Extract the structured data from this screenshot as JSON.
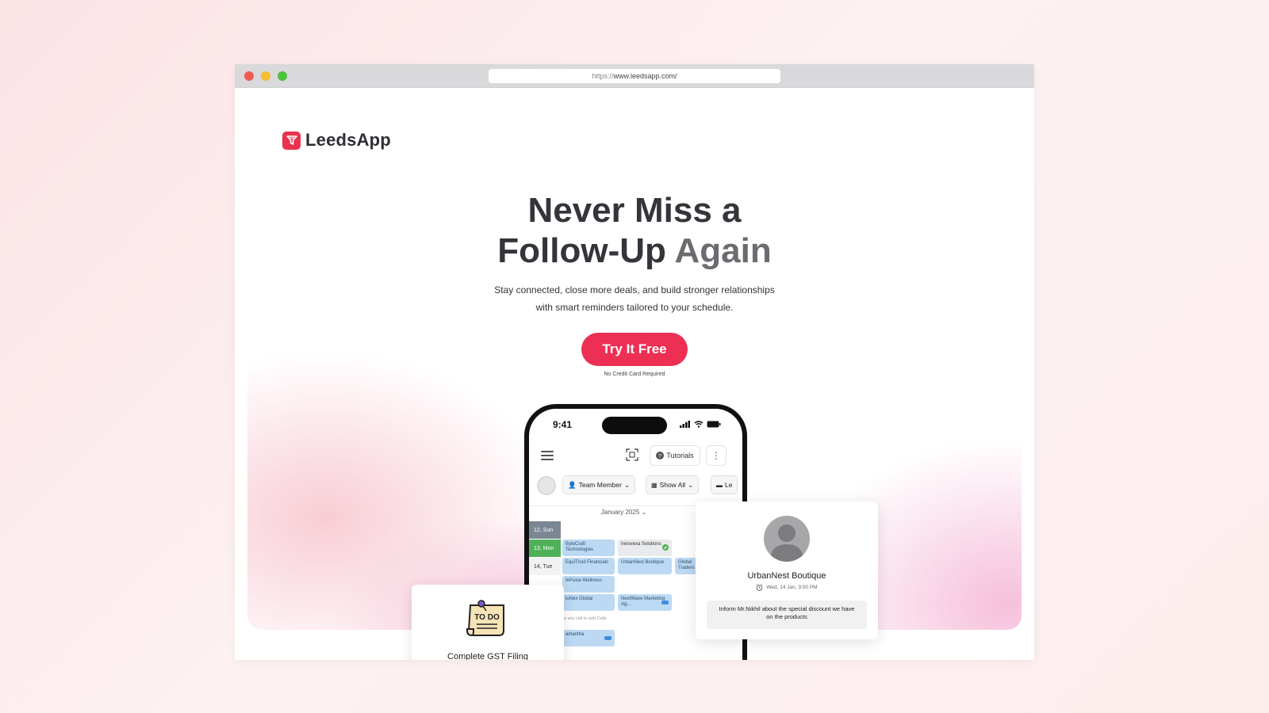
{
  "browser": {
    "url_scheme": "https://",
    "url_host": "www.leedsapp.com/"
  },
  "brand": {
    "name": "LeedsApp",
    "color": "#e8324f"
  },
  "hero": {
    "headline_line1": "Never Miss a",
    "headline_line2_main": "Follow-Up",
    "headline_line2_accent": "Again",
    "subtext_line1": "Stay connected, close more deals, and build stronger relationships",
    "subtext_line2": "with smart reminders tailored to your schedule.",
    "cta_label": "Try It Free",
    "cta_color": "#ec2f53",
    "cta_note": "No Credit Card Required"
  },
  "phone": {
    "time": "9:41",
    "tutorials_label": "Tutorials",
    "filter_team": "Team Member",
    "filter_show": "Show All",
    "filter_leads": "Le",
    "month": "January 2025",
    "days": [
      {
        "label": "12, Sun",
        "bg": "#7b8793",
        "color": "#ffffff"
      },
      {
        "label": "13, Mon",
        "bg": "#4fb058",
        "color": "#ffffff"
      },
      {
        "label": "14, Tue",
        "bg": "#f2f2f2",
        "color": "#333333"
      }
    ],
    "events": {
      "e1": "ByteCraft Technologies",
      "e2": "Innovexa Solutions",
      "e3": "EquiTrust Financials",
      "e4": "UrbanNest Boutique",
      "e5": "Global Traders",
      "e6": "fePulse Wellness",
      "e7": "luNex Global",
      "e8": "NextWave Marketing Ag...",
      "e9": "amantha"
    },
    "hint": "p any cell to add Calls"
  },
  "todo_card": {
    "title": "Complete GST Filing",
    "icon_text": "TO DO"
  },
  "contact_card": {
    "name": "UrbanNest Boutique",
    "time": "Wed, 14 Jan, 3:00 PM",
    "note": "Inform Mr.Nikhil about the special discount we have on the products"
  }
}
